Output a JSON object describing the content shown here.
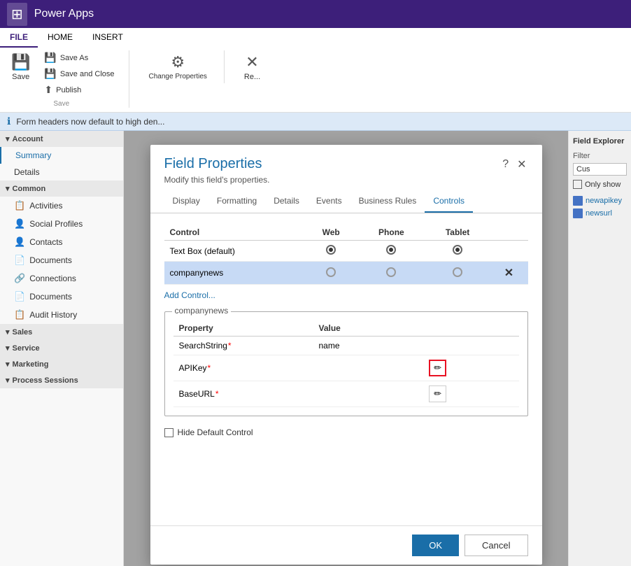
{
  "app": {
    "title": "Power Apps",
    "apps_icon": "⊞"
  },
  "ribbon": {
    "tabs": [
      "FILE",
      "HOME",
      "INSERT"
    ],
    "active_tab": "HOME",
    "save_label": "Save",
    "save_as_label": "Save As",
    "save_close_label": "Save and Close",
    "publish_label": "Publish",
    "change_properties_label": "Change Properties",
    "remove_label": "Re...",
    "save_group_label": "Save"
  },
  "info_bar": {
    "message": "Form headers now default to high den..."
  },
  "sidebar": {
    "sections": [
      {
        "name": "Account",
        "items": [
          {
            "label": "Summary",
            "icon": ""
          },
          {
            "label": "Details",
            "icon": ""
          }
        ]
      },
      {
        "name": "Common",
        "items": [
          {
            "label": "Activities",
            "icon": "📋"
          },
          {
            "label": "Social Profiles",
            "icon": "👤"
          },
          {
            "label": "Contacts",
            "icon": "👤"
          },
          {
            "label": "Documents",
            "icon": "📄"
          },
          {
            "label": "Connections",
            "icon": "🔗"
          },
          {
            "label": "Documents",
            "icon": "📄"
          },
          {
            "label": "Audit History",
            "icon": "📋"
          }
        ]
      },
      {
        "name": "Sales",
        "items": []
      },
      {
        "name": "Service",
        "items": []
      },
      {
        "name": "Marketing",
        "items": []
      },
      {
        "name": "Process Sessions",
        "items": []
      }
    ]
  },
  "right_panel": {
    "title": "Field Explorer",
    "filter_label": "Filter",
    "filter_placeholder": "Cus",
    "only_show_label": "Only show",
    "items": [
      {
        "label": "newapikey",
        "icon": "field"
      },
      {
        "label": "newsurl",
        "icon": "field"
      }
    ]
  },
  "modal": {
    "title": "Field Properties",
    "subtitle": "Modify this field's properties.",
    "help_icon": "?",
    "close_icon": "✕",
    "tabs": [
      "Display",
      "Formatting",
      "Details",
      "Events",
      "Business Rules",
      "Controls"
    ],
    "active_tab": "Controls",
    "table": {
      "headers": [
        "Control",
        "Web",
        "Phone",
        "Tablet"
      ],
      "rows": [
        {
          "control": "Text Box (default)",
          "web_checked": true,
          "phone_checked": true,
          "tablet_checked": true,
          "selected": false,
          "deletable": false
        },
        {
          "control": "companynews",
          "web_checked": false,
          "phone_checked": false,
          "tablet_checked": false,
          "selected": true,
          "deletable": true
        }
      ]
    },
    "add_control_label": "Add Control...",
    "companynews_section": {
      "label": "companynews",
      "property_header": "Property",
      "value_header": "Value",
      "rows": [
        {
          "property": "SearchString",
          "required": true,
          "value": "name",
          "has_edit": false
        },
        {
          "property": "APIKey",
          "required": true,
          "value": "",
          "has_edit": true,
          "edit_highlighted": true
        },
        {
          "property": "BaseURL",
          "required": true,
          "value": "",
          "has_edit": true,
          "edit_highlighted": false
        }
      ]
    },
    "hide_default_label": "Hide Default Control",
    "ok_label": "OK",
    "cancel_label": "Cancel"
  }
}
